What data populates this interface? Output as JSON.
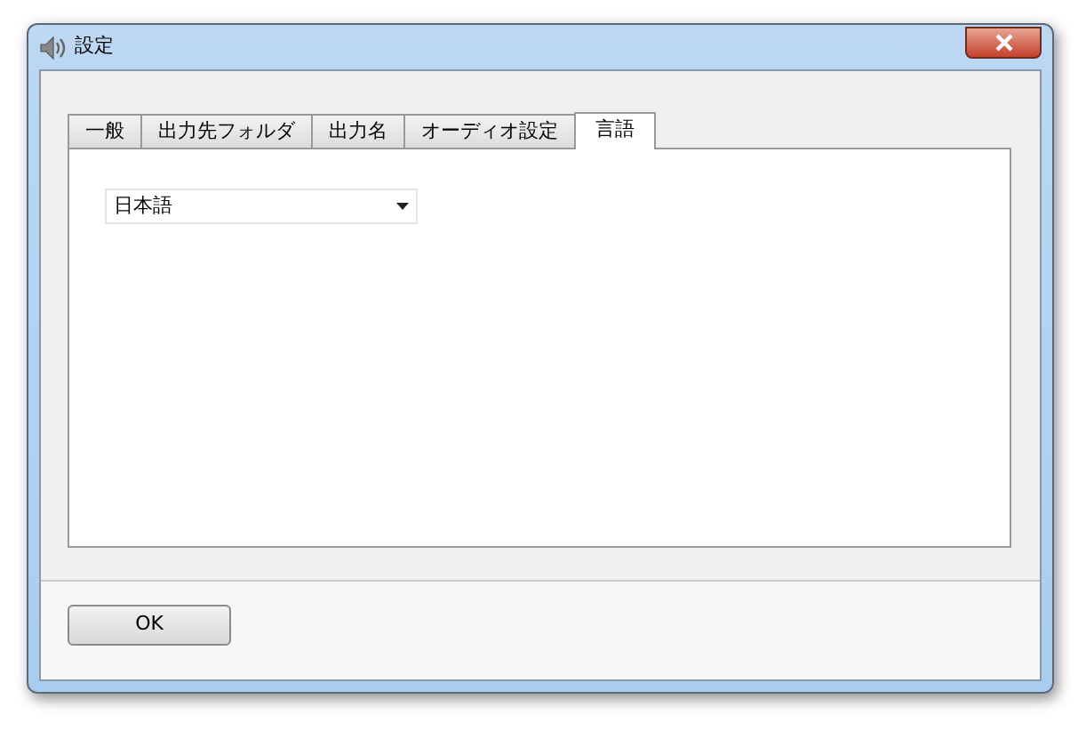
{
  "window": {
    "title": "設定"
  },
  "tabs": [
    {
      "label": "一般",
      "selected": false
    },
    {
      "label": "出力先フォルダ",
      "selected": false
    },
    {
      "label": "出力名",
      "selected": false
    },
    {
      "label": "オーディオ設定",
      "selected": false
    },
    {
      "label": "言語",
      "selected": true
    }
  ],
  "language_select": {
    "value": "日本語"
  },
  "buttons": [
    "OK"
  ]
}
